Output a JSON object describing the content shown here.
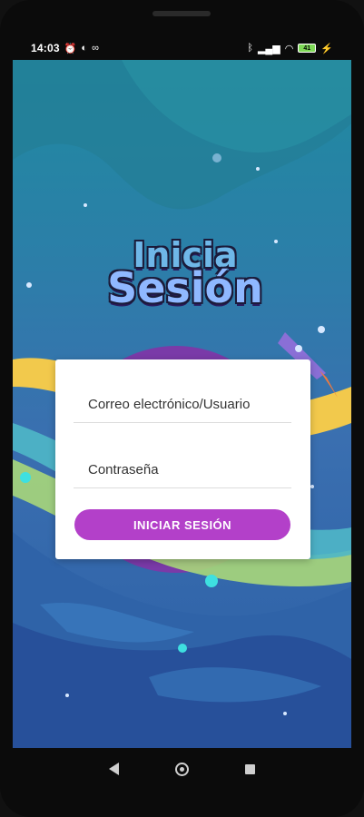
{
  "status_bar": {
    "time": "14:03",
    "left_icons": [
      "alarm-icon",
      "browser-icon",
      "voicemail-icon"
    ],
    "right_icons": [
      "bluetooth-icon",
      "signal-icon",
      "wifi-icon",
      "battery-icon",
      "charging-icon"
    ],
    "battery_label": "41"
  },
  "header": {
    "title_line1": "Inicia",
    "title_line2": "Sesión"
  },
  "login_form": {
    "email_placeholder": "Correo electrónico/Usuario",
    "password_placeholder": "Contraseña",
    "submit_label": "INICIAR SESIÓN"
  },
  "colors": {
    "accent": "#b340c9",
    "background_top": "#1f8aa0",
    "background_bottom": "#2c5fa6",
    "title_fill": "#6fb7e8"
  },
  "nav_bar": {
    "buttons": [
      "back-icon",
      "home-icon",
      "recents-icon"
    ]
  }
}
